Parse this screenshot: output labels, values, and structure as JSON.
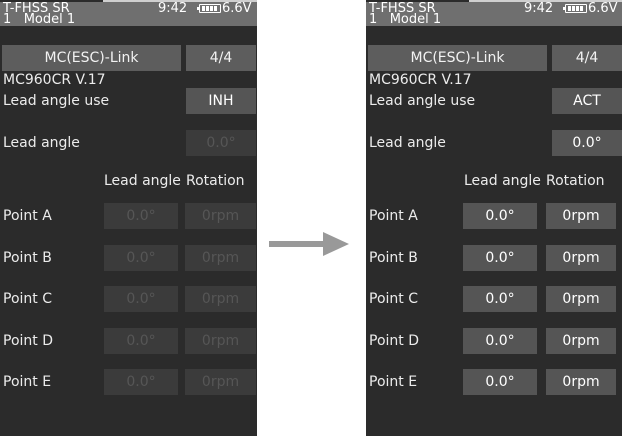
{
  "status": {
    "system": "T-FHSS SR",
    "time": "9:42",
    "voltage": "6.6V",
    "model_number": "1",
    "model_name": "Model 1"
  },
  "menu_title": "MC(ESC)-Link",
  "page_indicator": "4/4",
  "esc_version": "MC960CR V.17",
  "labels": {
    "lead_angle_use": "Lead angle use",
    "lead_angle": "Lead angle",
    "col_lead_angle": "Lead angle",
    "col_rotation": "Rotation"
  },
  "screens": {
    "before": {
      "lead_angle_use": "INH",
      "lead_angle": "0.0°",
      "points": [
        {
          "name": "Point A",
          "lead": "0.0°",
          "rotation": "0rpm"
        },
        {
          "name": "Point B",
          "lead": "0.0°",
          "rotation": "0rpm"
        },
        {
          "name": "Point C",
          "lead": "0.0°",
          "rotation": "0rpm"
        },
        {
          "name": "Point D",
          "lead": "0.0°",
          "rotation": "0rpm"
        },
        {
          "name": "Point E",
          "lead": "0.0°",
          "rotation": "0rpm"
        }
      ]
    },
    "after": {
      "lead_angle_use": "ACT",
      "lead_angle": "0.0°",
      "points": [
        {
          "name": "Point A",
          "lead": "0.0°",
          "rotation": "0rpm"
        },
        {
          "name": "Point B",
          "lead": "0.0°",
          "rotation": "0rpm"
        },
        {
          "name": "Point C",
          "lead": "0.0°",
          "rotation": "0rpm"
        },
        {
          "name": "Point D",
          "lead": "0.0°",
          "rotation": "0rpm"
        },
        {
          "name": "Point E",
          "lead": "0.0°",
          "rotation": "0rpm"
        }
      ]
    }
  },
  "icons": {
    "battery": "battery-icon",
    "arrow": "arrow-right-icon"
  },
  "colors": {
    "screen_bg": "#2b2b2b",
    "header_bg": "#6f6f6f",
    "button_bg": "#555555",
    "disabled_text": "#565656"
  }
}
